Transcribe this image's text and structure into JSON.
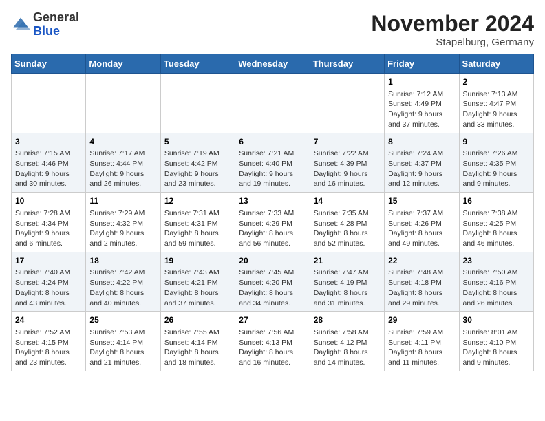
{
  "header": {
    "logo_line1": "General",
    "logo_line2": "Blue",
    "month_title": "November 2024",
    "location": "Stapelburg, Germany"
  },
  "weekdays": [
    "Sunday",
    "Monday",
    "Tuesday",
    "Wednesday",
    "Thursday",
    "Friday",
    "Saturday"
  ],
  "weeks": [
    [
      {
        "day": "",
        "info": ""
      },
      {
        "day": "",
        "info": ""
      },
      {
        "day": "",
        "info": ""
      },
      {
        "day": "",
        "info": ""
      },
      {
        "day": "",
        "info": ""
      },
      {
        "day": "1",
        "info": "Sunrise: 7:12 AM\nSunset: 4:49 PM\nDaylight: 9 hours and 37 minutes."
      },
      {
        "day": "2",
        "info": "Sunrise: 7:13 AM\nSunset: 4:47 PM\nDaylight: 9 hours and 33 minutes."
      }
    ],
    [
      {
        "day": "3",
        "info": "Sunrise: 7:15 AM\nSunset: 4:46 PM\nDaylight: 9 hours and 30 minutes."
      },
      {
        "day": "4",
        "info": "Sunrise: 7:17 AM\nSunset: 4:44 PM\nDaylight: 9 hours and 26 minutes."
      },
      {
        "day": "5",
        "info": "Sunrise: 7:19 AM\nSunset: 4:42 PM\nDaylight: 9 hours and 23 minutes."
      },
      {
        "day": "6",
        "info": "Sunrise: 7:21 AM\nSunset: 4:40 PM\nDaylight: 9 hours and 19 minutes."
      },
      {
        "day": "7",
        "info": "Sunrise: 7:22 AM\nSunset: 4:39 PM\nDaylight: 9 hours and 16 minutes."
      },
      {
        "day": "8",
        "info": "Sunrise: 7:24 AM\nSunset: 4:37 PM\nDaylight: 9 hours and 12 minutes."
      },
      {
        "day": "9",
        "info": "Sunrise: 7:26 AM\nSunset: 4:35 PM\nDaylight: 9 hours and 9 minutes."
      }
    ],
    [
      {
        "day": "10",
        "info": "Sunrise: 7:28 AM\nSunset: 4:34 PM\nDaylight: 9 hours and 6 minutes."
      },
      {
        "day": "11",
        "info": "Sunrise: 7:29 AM\nSunset: 4:32 PM\nDaylight: 9 hours and 2 minutes."
      },
      {
        "day": "12",
        "info": "Sunrise: 7:31 AM\nSunset: 4:31 PM\nDaylight: 8 hours and 59 minutes."
      },
      {
        "day": "13",
        "info": "Sunrise: 7:33 AM\nSunset: 4:29 PM\nDaylight: 8 hours and 56 minutes."
      },
      {
        "day": "14",
        "info": "Sunrise: 7:35 AM\nSunset: 4:28 PM\nDaylight: 8 hours and 52 minutes."
      },
      {
        "day": "15",
        "info": "Sunrise: 7:37 AM\nSunset: 4:26 PM\nDaylight: 8 hours and 49 minutes."
      },
      {
        "day": "16",
        "info": "Sunrise: 7:38 AM\nSunset: 4:25 PM\nDaylight: 8 hours and 46 minutes."
      }
    ],
    [
      {
        "day": "17",
        "info": "Sunrise: 7:40 AM\nSunset: 4:24 PM\nDaylight: 8 hours and 43 minutes."
      },
      {
        "day": "18",
        "info": "Sunrise: 7:42 AM\nSunset: 4:22 PM\nDaylight: 8 hours and 40 minutes."
      },
      {
        "day": "19",
        "info": "Sunrise: 7:43 AM\nSunset: 4:21 PM\nDaylight: 8 hours and 37 minutes."
      },
      {
        "day": "20",
        "info": "Sunrise: 7:45 AM\nSunset: 4:20 PM\nDaylight: 8 hours and 34 minutes."
      },
      {
        "day": "21",
        "info": "Sunrise: 7:47 AM\nSunset: 4:19 PM\nDaylight: 8 hours and 31 minutes."
      },
      {
        "day": "22",
        "info": "Sunrise: 7:48 AM\nSunset: 4:18 PM\nDaylight: 8 hours and 29 minutes."
      },
      {
        "day": "23",
        "info": "Sunrise: 7:50 AM\nSunset: 4:16 PM\nDaylight: 8 hours and 26 minutes."
      }
    ],
    [
      {
        "day": "24",
        "info": "Sunrise: 7:52 AM\nSunset: 4:15 PM\nDaylight: 8 hours and 23 minutes."
      },
      {
        "day": "25",
        "info": "Sunrise: 7:53 AM\nSunset: 4:14 PM\nDaylight: 8 hours and 21 minutes."
      },
      {
        "day": "26",
        "info": "Sunrise: 7:55 AM\nSunset: 4:14 PM\nDaylight: 8 hours and 18 minutes."
      },
      {
        "day": "27",
        "info": "Sunrise: 7:56 AM\nSunset: 4:13 PM\nDaylight: 8 hours and 16 minutes."
      },
      {
        "day": "28",
        "info": "Sunrise: 7:58 AM\nSunset: 4:12 PM\nDaylight: 8 hours and 14 minutes."
      },
      {
        "day": "29",
        "info": "Sunrise: 7:59 AM\nSunset: 4:11 PM\nDaylight: 8 hours and 11 minutes."
      },
      {
        "day": "30",
        "info": "Sunrise: 8:01 AM\nSunset: 4:10 PM\nDaylight: 8 hours and 9 minutes."
      }
    ]
  ]
}
